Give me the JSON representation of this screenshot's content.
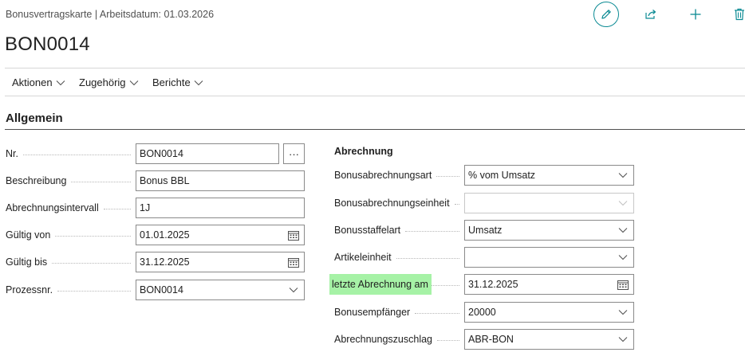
{
  "header": {
    "caption": "Bonusvertragskarte | Arbeitsdatum: 01.03.2026",
    "title": "BON0014"
  },
  "actions": {
    "icons": [
      "edit-pencil-icon",
      "share-icon",
      "plus-icon",
      "delete-icon"
    ],
    "accent": "#0a8a93"
  },
  "menu": {
    "items": [
      {
        "label": "Aktionen"
      },
      {
        "label": "Zugehörig"
      },
      {
        "label": "Berichte"
      }
    ]
  },
  "section": {
    "title": "Allgemein"
  },
  "left": {
    "nr": {
      "label": "Nr.",
      "value": "BON0014"
    },
    "beschreibung": {
      "label": "Beschreibung",
      "value": "Bonus BBL"
    },
    "abrechnungsintervall": {
      "label": "Abrechnungsintervall",
      "value": "1J"
    },
    "gueltig_von": {
      "label": "Gültig von",
      "value": "01.01.2025"
    },
    "gueltig_bis": {
      "label": "Gültig bis",
      "value": "31.12.2025"
    },
    "prozessnr": {
      "label": "Prozessnr.",
      "value": "BON0014"
    }
  },
  "right": {
    "group_label": "Abrechnung",
    "bonusabrechnungsart": {
      "label": "Bonusabrechnungsart",
      "value": "% vom Umsatz"
    },
    "bonusabrechnungseinheit": {
      "label": "Bonusabrechnungseinheit",
      "value": ""
    },
    "bonusstaffelart": {
      "label": "Bonusstaffelart",
      "value": "Umsatz"
    },
    "artikeleinheit": {
      "label": "Artikeleinheit",
      "value": ""
    },
    "letzte_abrechnung": {
      "label": "letzte Abrechnung am",
      "value": "31.12.2025",
      "highlight": "#a6f2a6"
    },
    "bonusempfaenger": {
      "label": "Bonusempfänger",
      "value": "20000"
    },
    "abrechnungszuschlag": {
      "label": "Abrechnungszuschlag",
      "value": "ABR-BON"
    }
  }
}
